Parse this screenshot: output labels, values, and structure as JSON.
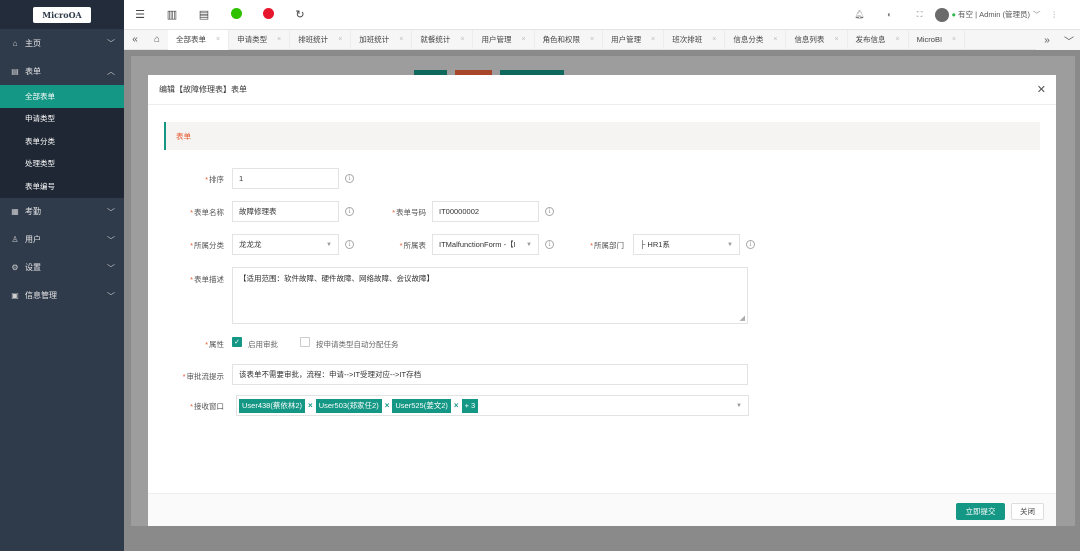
{
  "app": {
    "logo": "MicroOA"
  },
  "sidebar": {
    "items": [
      {
        "label": "主页",
        "icon": "home-icon"
      },
      {
        "label": "表单",
        "icon": "form-icon",
        "open": true
      },
      {
        "label": "考勤",
        "icon": "calendar-icon"
      },
      {
        "label": "用户",
        "icon": "user-icon"
      },
      {
        "label": "设置",
        "icon": "gear-icon"
      },
      {
        "label": "信息管理",
        "icon": "info-icon"
      }
    ],
    "subitems": [
      "全部表单",
      "申请类型",
      "表单分类",
      "处理类型",
      "表单编号"
    ]
  },
  "header": {
    "user": "有空 | Admin (管理员)"
  },
  "tabs": [
    "全部表单",
    "申请类型",
    "排班统计",
    "加班统计",
    "就餐统计",
    "用户管理",
    "角色和权限",
    "用户管理",
    "班次排班",
    "信息分类",
    "信息列表",
    "发布信息",
    "MicroBI"
  ],
  "modal": {
    "title": "编辑【故障修理表】表单",
    "section": "表单",
    "fields": {
      "order": {
        "label": "排序",
        "value": "1"
      },
      "name": {
        "label": "表单名称",
        "value": "故障修理表"
      },
      "code": {
        "label": "表单号码",
        "value": "IT00000002"
      },
      "category": {
        "label": "所属分类",
        "value": "龙龙龙"
      },
      "table": {
        "label": "所属表",
        "value": "ITMalfunctionForm -【I"
      },
      "dept": {
        "label": "所属部门",
        "value": "├ HR1系"
      },
      "desc": {
        "label": "表单描述",
        "value": "【适用范围：软件故障、硬件故障、网络故障、会议故障】"
      },
      "attr": {
        "label": "属性",
        "opt1": "启用审批",
        "opt2": "按申请类型自动分配任务",
        "opt1_checked": true,
        "opt2_checked": false
      },
      "hint": {
        "label": "审批流提示",
        "value": "该表单不需要审批，流程：申请-->IT受理对应-->IT存档"
      },
      "receiver": {
        "label": "接收窗口",
        "tags": [
          "User438(蔡依林2)",
          "User503(郑家任2)",
          "User525(姜文2)"
        ],
        "more": "+ 3"
      }
    },
    "buttons": {
      "submit": "立即提交",
      "close": "关闭"
    }
  },
  "colors": {
    "accent": "#149785",
    "sidebar": "#2f3a4b",
    "required": "#e4572e"
  }
}
